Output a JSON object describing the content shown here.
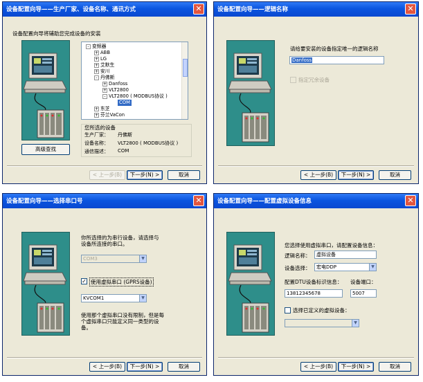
{
  "icons": {
    "close": "close-icon",
    "computer": "computer-illustration",
    "device": "device-rack-illustration"
  },
  "colors": {
    "titlebar": "#0b55e0",
    "dialog_bg": "#ece9d8",
    "illustration_bg": "#2e8e8a"
  },
  "common": {
    "back_label": "< 上一步(B)",
    "next_label": "下一步(N) >",
    "cancel_label": "取消",
    "close_glyph": "✕"
  },
  "dialog1": {
    "title": "设备配置向导——生产厂家、设备名称、通讯方式",
    "intro": "设备配置向导将辅助您完成设备的安装",
    "advanced_search_label": "高级查找",
    "tree": [
      {
        "label": "变频器",
        "expander": "-"
      },
      {
        "label": "ABB",
        "expander": "+"
      },
      {
        "label": "LG",
        "expander": "+"
      },
      {
        "label": "艾默生",
        "expander": "+"
      },
      {
        "label": "安川",
        "expander": "+"
      },
      {
        "label": "丹佛斯",
        "expander": "-"
      },
      {
        "label": "Danfoss",
        "expander": "+"
      },
      {
        "label": "VLT2800",
        "expander": "+"
      },
      {
        "label": "VLT2800 ( MODBUS协议 )",
        "expander": "-"
      },
      {
        "label": "COM",
        "expander": ""
      },
      {
        "label": "东芝",
        "expander": "+"
      },
      {
        "label": "芬兰VaCon",
        "expander": "+"
      }
    ],
    "selected_group_title": "您所选的设备",
    "manufacturer_label": "生产厂家：",
    "manufacturer_value": "丹佛斯",
    "device_name_label": "设备名称：",
    "device_name_value": "VLT2800 ( MODBUS协议 )",
    "comm_label": "通信描述：",
    "comm_value": "COM"
  },
  "dialog2": {
    "title": "设备配置向导——逻辑名称",
    "prompt": "请给要安装的设备指定唯一的逻辑名称",
    "logical_name_value": "Danfoss",
    "redundant_label": "指定冗余设备"
  },
  "dialog3": {
    "title": "设备配置向导——选择串口号",
    "prompt_line1": "你所选择的为串行设备，请选择与",
    "prompt_line2": "设备所连接的串口。",
    "com_value": "COM3",
    "virtual_label": "使用虚拟串口 (GPRS设备)",
    "virtual_checked": "✓",
    "virtual_value": "KVCOM1",
    "note_line1": "使用那个虚拟串口没有限制，但是每",
    "note_line2": "个虚拟串口只能定义同一类型的设",
    "note_line3": "备。"
  },
  "dialog4": {
    "title": "设备配置向导——配置虚拟设备信息",
    "prompt": "您选择使用虚拟串口，请配置设备信息：",
    "logical_label": "逻辑名称：",
    "logical_value": "虚拟设备",
    "device_select_label": "设备选择：",
    "device_select_value": "宏电DDP",
    "dtu_label": "配置DTU设备标识信息：",
    "port_label": "设备端口：",
    "dtu_value": "13812345678",
    "port_value": "5007",
    "custom_label": "选择已定义的虚拟设备："
  }
}
